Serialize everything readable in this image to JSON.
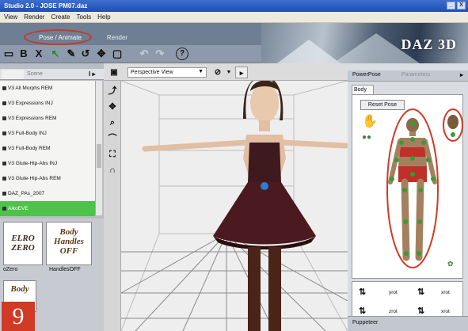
{
  "app": {
    "title": "Studio 2.0 - JOSE PM07.daz",
    "menu": [
      "View",
      "Render",
      "Create",
      "Tools",
      "Help"
    ],
    "window_buttons": [
      "_",
      "X"
    ],
    "logo": "DAZ 3D"
  },
  "tabs": {
    "pose": "Pose / Animate",
    "render": "Render"
  },
  "toolbar": {
    "icons": [
      "new-scene-icon",
      "save-icon",
      "delete-icon",
      "select-icon",
      "node-select-icon",
      "rotate-icon",
      "translate-icon",
      "frame-icon",
      "undo-icon",
      "redo-icon",
      "help-icon"
    ],
    "glyphs": {
      "save": "B",
      "delete": "X",
      "select": "↖",
      "rotate": "↺",
      "move": "✥",
      "frame": "▢",
      "undo": "↶",
      "redo": "↷",
      "help": "?"
    }
  },
  "left_panel": {
    "tab1": "",
    "tab2": "Scene",
    "items": [
      "V3 All Morphs REM",
      "V3 Expressions INJ",
      "V3 Expressions REM",
      "V3 Full-Body INJ",
      "V3 Full-Body REM",
      "V3 Glute-Hip-Abs INJ",
      "V3 Glute-Hip-Abs REM",
      "DAZ_PAs_2007",
      "AikoEVE"
    ],
    "selected_index": 8,
    "thumbnails": [
      {
        "art": "ELRO\nZERO",
        "label": "oZero"
      },
      {
        "art": "Body\nHandles\nOFF",
        "label": "HandlesOFF"
      },
      {
        "art": "Body",
        "label": ""
      }
    ]
  },
  "viewport": {
    "camera": "Perspective View"
  },
  "right_panel": {
    "tab1": "PowerPose",
    "tab2": "Parameters",
    "body_tab": "Body",
    "reset": "Reset Pose",
    "rot_labels": [
      "yrot",
      "xrot",
      "zrot",
      "xrot"
    ]
  },
  "puppeteer": "Puppeteer",
  "badge": "9",
  "colors": {
    "accent": "#d13a25",
    "highlight": "#4ec24a",
    "banner": "#6f7f93"
  }
}
